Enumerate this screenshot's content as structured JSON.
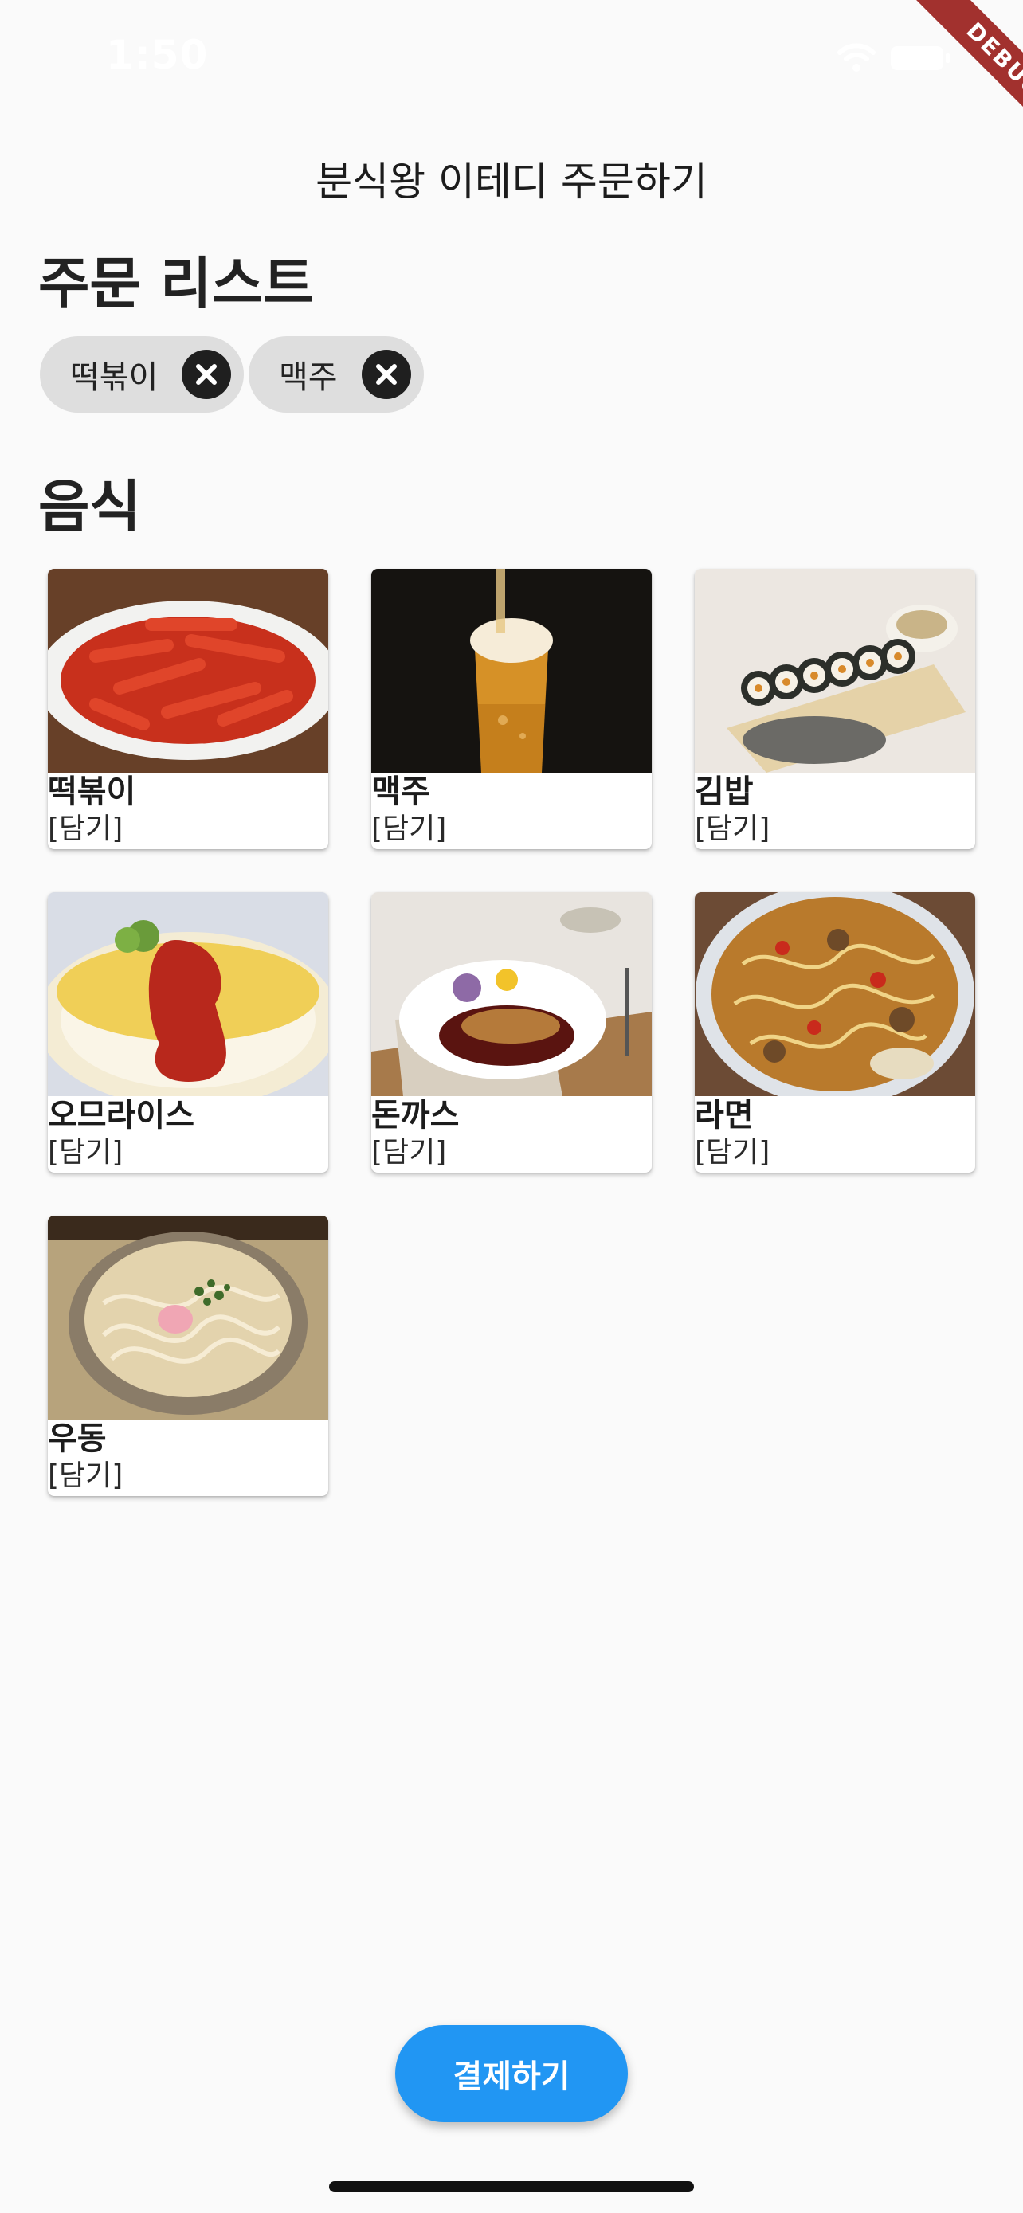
{
  "status_bar": {
    "time": "1:50",
    "icons": [
      "wifi-icon",
      "battery-icon"
    ]
  },
  "debug_banner": "DEBUG",
  "app_bar": {
    "title": "분식왕 이테디 주문하기"
  },
  "order_section": {
    "title": "주문 리스트",
    "chips": [
      {
        "label": "떡볶이",
        "delete_icon": "close-circle-icon"
      },
      {
        "label": "맥주",
        "delete_icon": "close-circle-icon"
      }
    ]
  },
  "food_section": {
    "title": "음식",
    "items": [
      {
        "name": "떡볶이",
        "action": "[담기]"
      },
      {
        "name": "맥주",
        "action": "[담기]"
      },
      {
        "name": "김밥",
        "action": "[담기]"
      },
      {
        "name": "오므라이스",
        "action": "[담기]"
      },
      {
        "name": "돈까스",
        "action": "[담기]"
      },
      {
        "name": "라면",
        "action": "[담기]"
      },
      {
        "name": "우동",
        "action": "[담기]"
      }
    ]
  },
  "pay_button": {
    "label": "결제하기"
  },
  "colors": {
    "accent": "#2196f3",
    "chip_bg": "#dedede",
    "background": "#fafafa"
  }
}
